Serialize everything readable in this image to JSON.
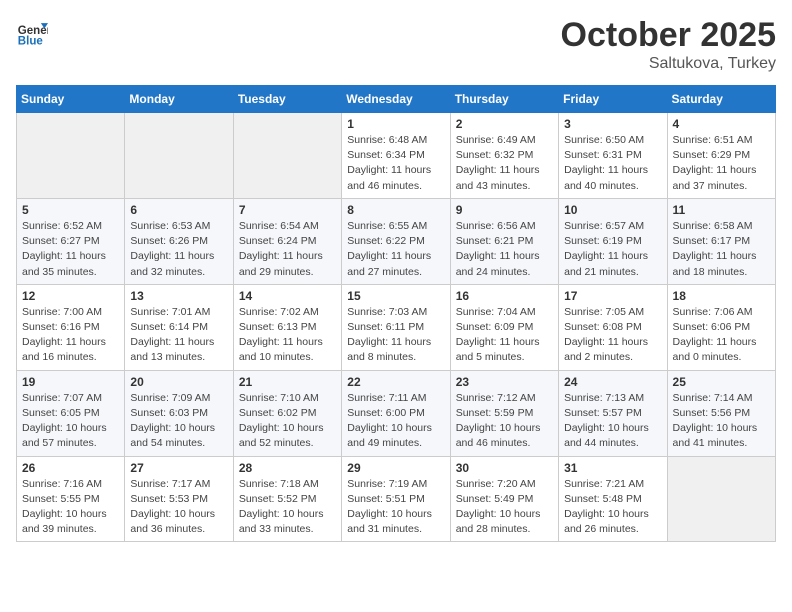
{
  "header": {
    "logo_general": "General",
    "logo_blue": "Blue",
    "title": "October 2025",
    "location": "Saltukova, Turkey"
  },
  "days_of_week": [
    "Sunday",
    "Monday",
    "Tuesday",
    "Wednesday",
    "Thursday",
    "Friday",
    "Saturday"
  ],
  "weeks": [
    [
      {
        "day": "",
        "info": ""
      },
      {
        "day": "",
        "info": ""
      },
      {
        "day": "",
        "info": ""
      },
      {
        "day": "1",
        "info": "Sunrise: 6:48 AM\nSunset: 6:34 PM\nDaylight: 11 hours and 46 minutes."
      },
      {
        "day": "2",
        "info": "Sunrise: 6:49 AM\nSunset: 6:32 PM\nDaylight: 11 hours and 43 minutes."
      },
      {
        "day": "3",
        "info": "Sunrise: 6:50 AM\nSunset: 6:31 PM\nDaylight: 11 hours and 40 minutes."
      },
      {
        "day": "4",
        "info": "Sunrise: 6:51 AM\nSunset: 6:29 PM\nDaylight: 11 hours and 37 minutes."
      }
    ],
    [
      {
        "day": "5",
        "info": "Sunrise: 6:52 AM\nSunset: 6:27 PM\nDaylight: 11 hours and 35 minutes."
      },
      {
        "day": "6",
        "info": "Sunrise: 6:53 AM\nSunset: 6:26 PM\nDaylight: 11 hours and 32 minutes."
      },
      {
        "day": "7",
        "info": "Sunrise: 6:54 AM\nSunset: 6:24 PM\nDaylight: 11 hours and 29 minutes."
      },
      {
        "day": "8",
        "info": "Sunrise: 6:55 AM\nSunset: 6:22 PM\nDaylight: 11 hours and 27 minutes."
      },
      {
        "day": "9",
        "info": "Sunrise: 6:56 AM\nSunset: 6:21 PM\nDaylight: 11 hours and 24 minutes."
      },
      {
        "day": "10",
        "info": "Sunrise: 6:57 AM\nSunset: 6:19 PM\nDaylight: 11 hours and 21 minutes."
      },
      {
        "day": "11",
        "info": "Sunrise: 6:58 AM\nSunset: 6:17 PM\nDaylight: 11 hours and 18 minutes."
      }
    ],
    [
      {
        "day": "12",
        "info": "Sunrise: 7:00 AM\nSunset: 6:16 PM\nDaylight: 11 hours and 16 minutes."
      },
      {
        "day": "13",
        "info": "Sunrise: 7:01 AM\nSunset: 6:14 PM\nDaylight: 11 hours and 13 minutes."
      },
      {
        "day": "14",
        "info": "Sunrise: 7:02 AM\nSunset: 6:13 PM\nDaylight: 11 hours and 10 minutes."
      },
      {
        "day": "15",
        "info": "Sunrise: 7:03 AM\nSunset: 6:11 PM\nDaylight: 11 hours and 8 minutes."
      },
      {
        "day": "16",
        "info": "Sunrise: 7:04 AM\nSunset: 6:09 PM\nDaylight: 11 hours and 5 minutes."
      },
      {
        "day": "17",
        "info": "Sunrise: 7:05 AM\nSunset: 6:08 PM\nDaylight: 11 hours and 2 minutes."
      },
      {
        "day": "18",
        "info": "Sunrise: 7:06 AM\nSunset: 6:06 PM\nDaylight: 11 hours and 0 minutes."
      }
    ],
    [
      {
        "day": "19",
        "info": "Sunrise: 7:07 AM\nSunset: 6:05 PM\nDaylight: 10 hours and 57 minutes."
      },
      {
        "day": "20",
        "info": "Sunrise: 7:09 AM\nSunset: 6:03 PM\nDaylight: 10 hours and 54 minutes."
      },
      {
        "day": "21",
        "info": "Sunrise: 7:10 AM\nSunset: 6:02 PM\nDaylight: 10 hours and 52 minutes."
      },
      {
        "day": "22",
        "info": "Sunrise: 7:11 AM\nSunset: 6:00 PM\nDaylight: 10 hours and 49 minutes."
      },
      {
        "day": "23",
        "info": "Sunrise: 7:12 AM\nSunset: 5:59 PM\nDaylight: 10 hours and 46 minutes."
      },
      {
        "day": "24",
        "info": "Sunrise: 7:13 AM\nSunset: 5:57 PM\nDaylight: 10 hours and 44 minutes."
      },
      {
        "day": "25",
        "info": "Sunrise: 7:14 AM\nSunset: 5:56 PM\nDaylight: 10 hours and 41 minutes."
      }
    ],
    [
      {
        "day": "26",
        "info": "Sunrise: 7:16 AM\nSunset: 5:55 PM\nDaylight: 10 hours and 39 minutes."
      },
      {
        "day": "27",
        "info": "Sunrise: 7:17 AM\nSunset: 5:53 PM\nDaylight: 10 hours and 36 minutes."
      },
      {
        "day": "28",
        "info": "Sunrise: 7:18 AM\nSunset: 5:52 PM\nDaylight: 10 hours and 33 minutes."
      },
      {
        "day": "29",
        "info": "Sunrise: 7:19 AM\nSunset: 5:51 PM\nDaylight: 10 hours and 31 minutes."
      },
      {
        "day": "30",
        "info": "Sunrise: 7:20 AM\nSunset: 5:49 PM\nDaylight: 10 hours and 28 minutes."
      },
      {
        "day": "31",
        "info": "Sunrise: 7:21 AM\nSunset: 5:48 PM\nDaylight: 10 hours and 26 minutes."
      },
      {
        "day": "",
        "info": ""
      }
    ]
  ]
}
